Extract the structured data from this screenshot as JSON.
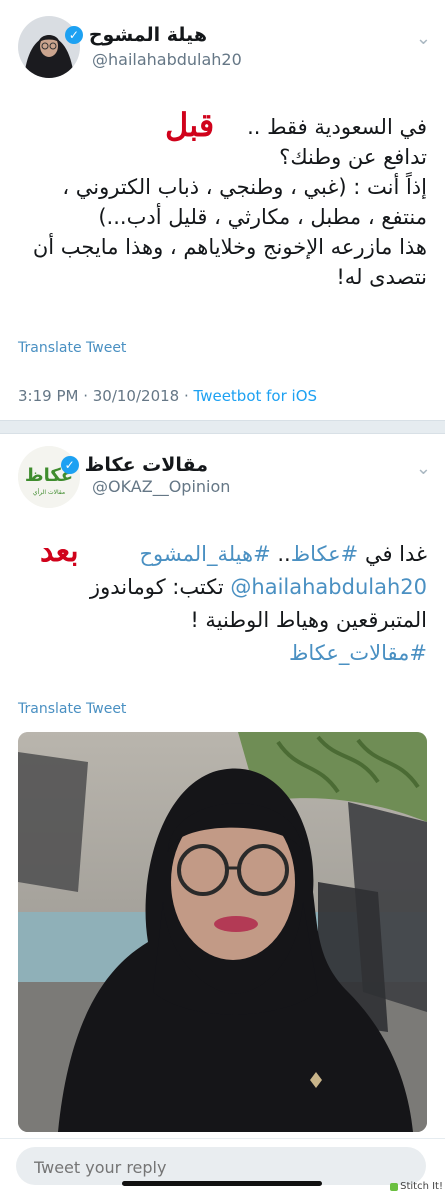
{
  "tweet1": {
    "display_name": "هيلة المشوح",
    "handle": "@hailahabdulah20",
    "overlay_label": "قبل",
    "lines": [
      "في السعودية فقط ..",
      "تدافع عن وطنك؟",
      "إذاً أنت : (غبي ، وطنجي ، ذباب الكتروني ،",
      "منتفع ، مطبل ، مكارثي ، قليل أدب...)",
      "هذا مازرعه الإخونج وخلاياهم ، وهذا مايجب أن",
      "نتصدى له!"
    ],
    "translate_label": "Translate Tweet",
    "time": "3:19 PM · 30/10/2018 · ",
    "app": "Tweetbot for iOS"
  },
  "tweet2": {
    "display_name": "مقالات عكاظ",
    "handle": "@OKAZ__Opinion",
    "avatar_text": "عكاظ",
    "avatar_subtext": "مقالات الرأي",
    "overlay_label": "بعد",
    "line1_plain": "غدا في ",
    "line1_tag1": "#عكاظ",
    "line1_mid": ".. ",
    "line1_tag2": "#هيلة_المشوح",
    "line2_mention": "@hailahabdulah20",
    "line2_plain": " تكتب: كوماندوز",
    "line3": "المتبرقعين وهياط الوطنية !",
    "line4_tag": "#مقالات_عكاظ",
    "translate_label": "Translate Tweet"
  },
  "reply": {
    "placeholder": "Tweet your reply"
  },
  "watermark": "Stitch It!",
  "colors": {
    "accent": "#1da1f2",
    "link": "#4a90c2",
    "overlay_red": "#d0021b",
    "okaz_green": "#3f8c2e"
  }
}
